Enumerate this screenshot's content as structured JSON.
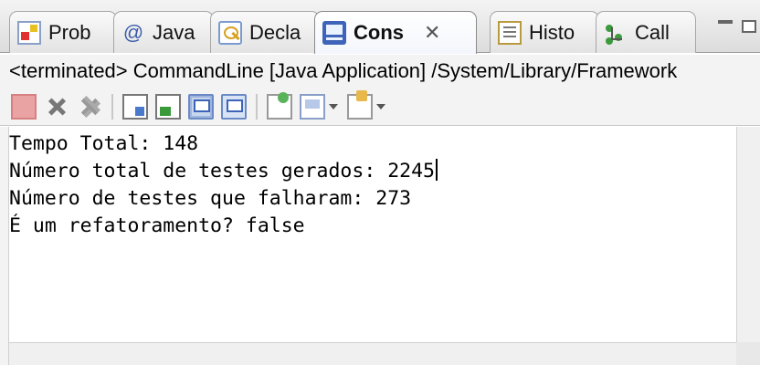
{
  "tabs": [
    {
      "label": "Prob",
      "icon": "problems-icon"
    },
    {
      "label": "Java",
      "icon": "javadoc-icon",
      "glyph": "@"
    },
    {
      "label": "Decla",
      "icon": "declaration-icon"
    },
    {
      "label": "Cons",
      "icon": "console-icon",
      "active": true,
      "close_glyph": "✕"
    },
    {
      "label": "Histo",
      "icon": "history-icon"
    },
    {
      "label": "Call",
      "icon": "call-hierarchy-icon"
    }
  ],
  "status": "<terminated> CommandLine [Java Application] /System/Library/Framework",
  "console": {
    "lines": [
      "Tempo Total: 148",
      "Número total de testes gerados: 2245",
      "Número de testes que falharam: 273",
      "É um refatoramento? false"
    ]
  }
}
